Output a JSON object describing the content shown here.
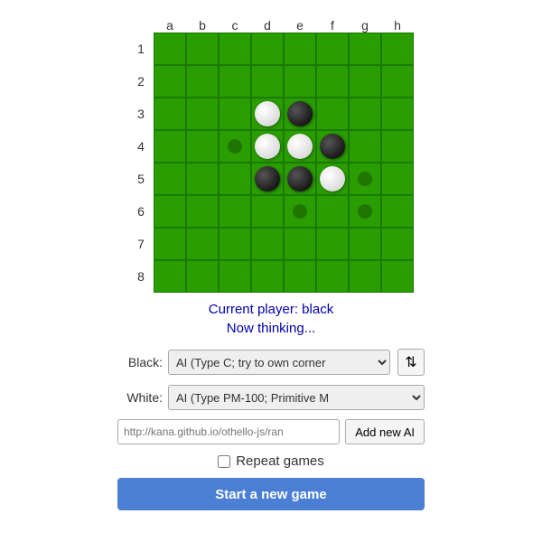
{
  "board": {
    "col_labels": [
      "a",
      "b",
      "c",
      "d",
      "e",
      "f",
      "g",
      "h"
    ],
    "row_labels": [
      "1",
      "2",
      "3",
      "4",
      "5",
      "6",
      "7",
      "8"
    ],
    "cells": [
      [
        "",
        "",
        "",
        "",
        "",
        "",
        "",
        ""
      ],
      [
        "",
        "",
        "",
        "",
        "",
        "",
        "",
        ""
      ],
      [
        "",
        "",
        "",
        "white",
        "black",
        "",
        "",
        ""
      ],
      [
        "",
        "",
        "hint",
        "white",
        "white",
        "black",
        "",
        ""
      ],
      [
        "",
        "",
        "",
        "black",
        "black",
        "white",
        "hint",
        ""
      ],
      [
        "",
        "",
        "",
        "",
        "hint",
        "",
        "hint",
        ""
      ],
      [
        "",
        "",
        "",
        "",
        "",
        "",
        "",
        ""
      ],
      [
        "",
        "",
        "",
        "",
        "",
        "",
        "",
        ""
      ]
    ]
  },
  "status": {
    "current_player_label": "Current player:",
    "current_player_value": "black",
    "thinking_text": "Now thinking..."
  },
  "controls": {
    "black_label": "Black:",
    "white_label": "White:",
    "black_select_value": "AI (Type C; try to own corner",
    "white_select_value": "AI (Type PM-100; Primitive M",
    "swap_icon": "⇅",
    "url_placeholder": "http://kana.github.io/othello-js/ran",
    "add_ai_label": "Add new AI",
    "repeat_label": "Repeat games",
    "start_label": "Start a new game"
  }
}
